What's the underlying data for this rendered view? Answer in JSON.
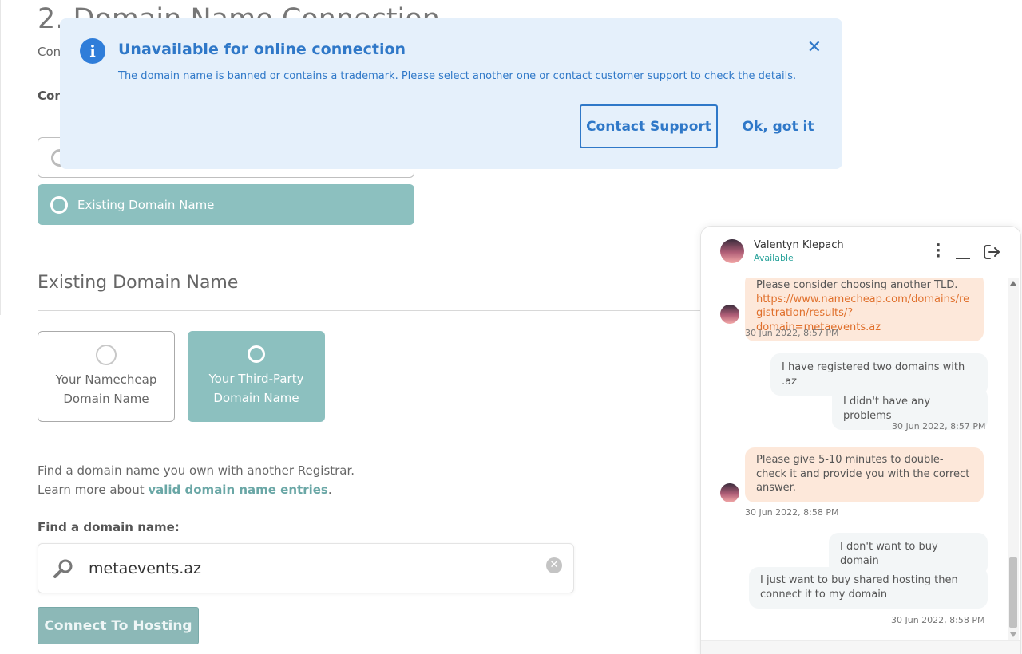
{
  "page": {
    "section_title": "2. Domain Name Connection",
    "peek_line_1": "Con",
    "peek_line_2": "Con",
    "option_selected_label": "Existing Domain Name",
    "heading": "Existing Domain Name",
    "cards": [
      {
        "label_line1": "Your Namecheap",
        "label_line2": "Domain Name",
        "selected": false
      },
      {
        "label_line1": "Your Third-Party",
        "label_line2": "Domain Name",
        "selected": true
      }
    ],
    "info_line1": "Find a domain name you own with another Registrar.",
    "info_line2_prefix": "Learn more about ",
    "info_link": "valid domain name entries",
    "info_line2_suffix": ".",
    "find_label": "Find a domain name:",
    "search_value": "metaevents.az",
    "connect_button": "Connect To Hosting",
    "accent_color": "#8cc0bf"
  },
  "alert": {
    "icon": "info-icon",
    "title": "Unavailable for online connection",
    "message": "The domain name is banned or contains a trademark. Please select another one or contact customer support to check the details.",
    "close_icon": "close-icon",
    "support_button": "Contact Support",
    "ok_button": "Ok, got it",
    "color": "#2f78c8"
  },
  "chat": {
    "agent_name": "Valentyn Klepach",
    "agent_status": "Available",
    "messages": [
      {
        "from": "agent",
        "text": "Please consider choosing another TLD.",
        "link": "https://www.namecheap.com/domains/registration/results/?domain=metaevents.az",
        "link_line1": "https://www.namecheap.com/domains/re",
        "link_line2": "gistration/results/?domain=metaevents.az",
        "time": "30 Jun 2022, 8:57 PM"
      },
      {
        "from": "user",
        "text": "I have registered two domains with .az"
      },
      {
        "from": "user",
        "text": "I didn't have any problems",
        "time": "30 Jun 2022, 8:57 PM"
      },
      {
        "from": "agent",
        "text": "Please give 5-10 minutes to double-check it and provide you with the correct answer.",
        "time": "30 Jun 2022, 8:58 PM"
      },
      {
        "from": "user",
        "text": "I don't want to buy domain"
      },
      {
        "from": "user",
        "text": "I just want to buy shared hosting then connect it to my domain",
        "time": "30 Jun 2022, 8:58 PM"
      }
    ]
  }
}
